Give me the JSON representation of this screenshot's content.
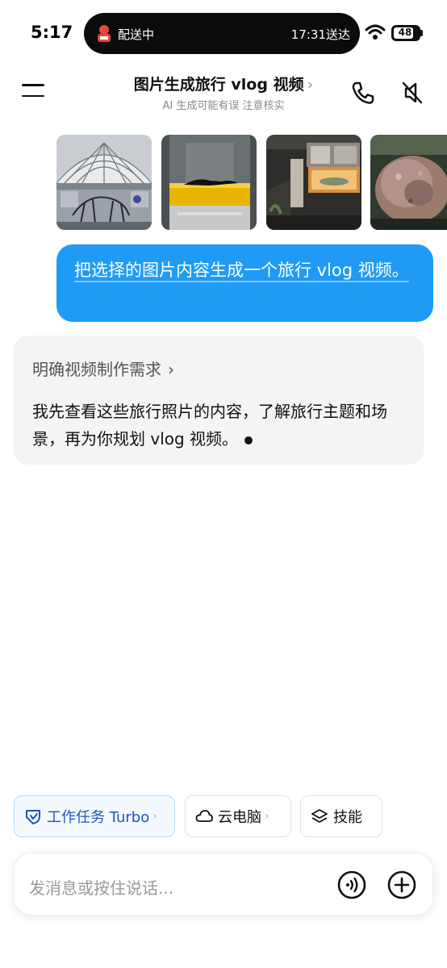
{
  "status_bar": {
    "time": "5:17",
    "island_left": "配送中",
    "island_right": "17:31送达",
    "battery": "48"
  },
  "header": {
    "title": "图片生成旅行 vlog 视频",
    "title_chevron": "›",
    "subtitle": "AI 生成可能有误 注意核实"
  },
  "images": [
    {
      "name": "museum-atrium-skeleton"
    },
    {
      "name": "black-fossil-on-yellow-base"
    },
    {
      "name": "exhibition-hall-display"
    },
    {
      "name": "mineral-specimen"
    }
  ],
  "user_message": {
    "text": "把选择的图片内容生成一个旅行 vlog 视频。"
  },
  "assistant": {
    "requirement_link": "明确视频制作需求",
    "chevron": "›",
    "text": "我先查看这些旅行照片的内容，了解旅行主题和场景，再为你规划 vlog 视频。"
  },
  "chips": {
    "work": "工作任务 Turbo",
    "cloud": "云电脑",
    "skill": "技能",
    "chevron": "›"
  },
  "input": {
    "placeholder": "发消息或按住说话..."
  },
  "colors": {
    "accent_blue": "#1f9bf5",
    "work_chip_text": "#1a57b8"
  }
}
